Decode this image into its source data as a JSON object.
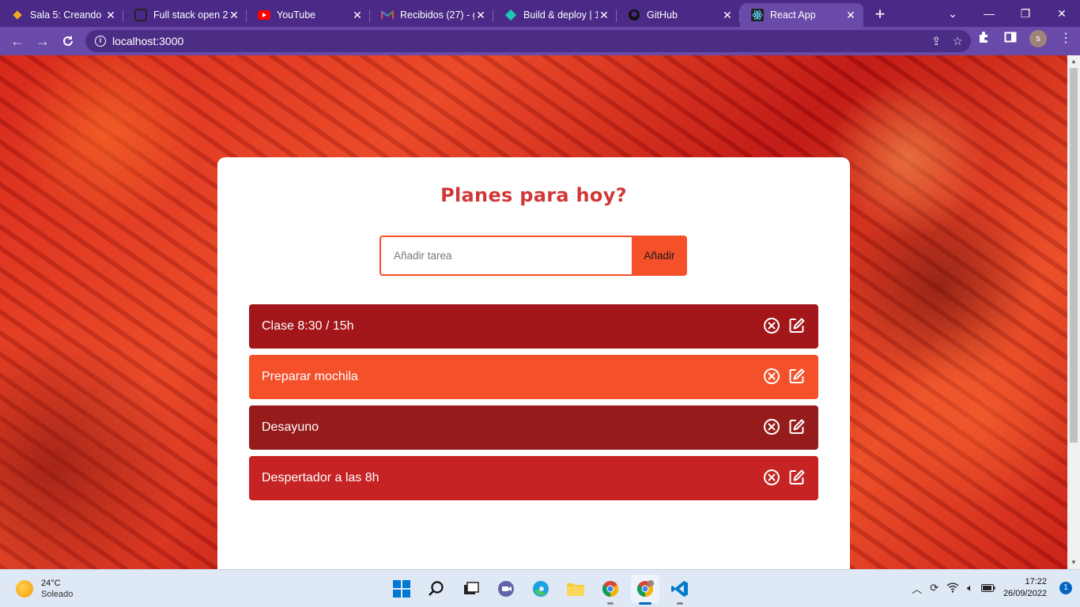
{
  "browser": {
    "tabs": [
      {
        "title": "Sala 5: Creando e",
        "icon": "diamond-orange-icon",
        "active": false
      },
      {
        "title": "Full stack open 20",
        "icon": "fullstack-icon",
        "active": false
      },
      {
        "title": "YouTube",
        "icon": "youtube-icon",
        "active": false
      },
      {
        "title": "Recibidos (27) - g",
        "icon": "gmail-icon",
        "active": false
      },
      {
        "title": "Build & deploy | 1",
        "icon": "netlify-icon",
        "active": false
      },
      {
        "title": "GitHub",
        "icon": "github-icon",
        "active": false
      },
      {
        "title": "React App",
        "icon": "react-icon",
        "active": true
      }
    ],
    "url": "localhost:3000",
    "profile_initial": "s"
  },
  "app": {
    "heading": "Planes para hoy?",
    "input_placeholder": "Añadir tarea",
    "add_button": "Añadir",
    "todos": [
      {
        "text": "Clase 8:30 / 15h",
        "color": "#a3161a"
      },
      {
        "text": "Preparar mochila",
        "color": "#f4502a"
      },
      {
        "text": "Desayuno",
        "color": "#961b1b"
      },
      {
        "text": "Despertador a las 8h",
        "color": "#c62424"
      }
    ]
  },
  "taskbar": {
    "weather_temp": "24°C",
    "weather_condition": "Soleado",
    "time": "17:22",
    "date": "26/09/2022",
    "notification_count": "1"
  }
}
